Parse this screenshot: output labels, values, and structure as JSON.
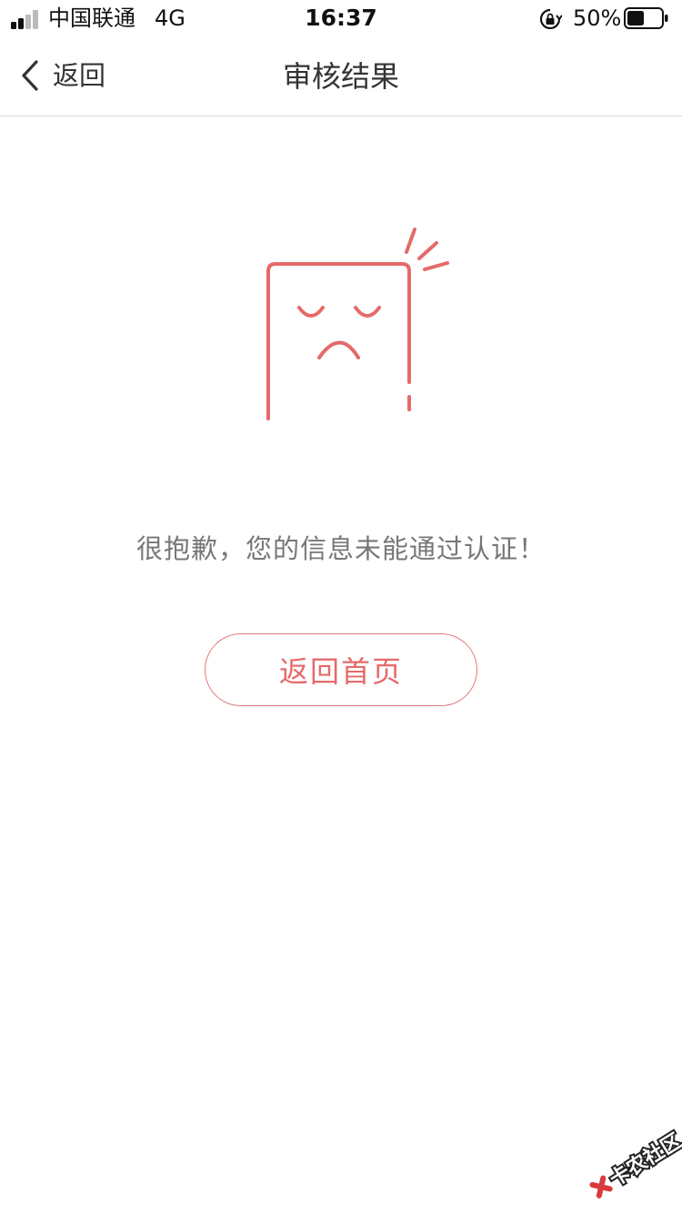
{
  "status_bar": {
    "carrier": "中国联通",
    "network": "4G",
    "time": "16:37",
    "battery": "50%",
    "battery_level": 0.5
  },
  "nav": {
    "back_label": "返回",
    "title": "审核结果"
  },
  "result": {
    "illustration_icon": "sad-card-icon",
    "message": "很抱歉，您的信息未能通过认证！",
    "home_button_label": "返回首页"
  },
  "watermark": {
    "text": "卡农社区"
  },
  "colors": {
    "accent": "#e56a6a",
    "text_primary": "#333333",
    "text_secondary": "#777777",
    "divider": "#d9d9d9"
  }
}
